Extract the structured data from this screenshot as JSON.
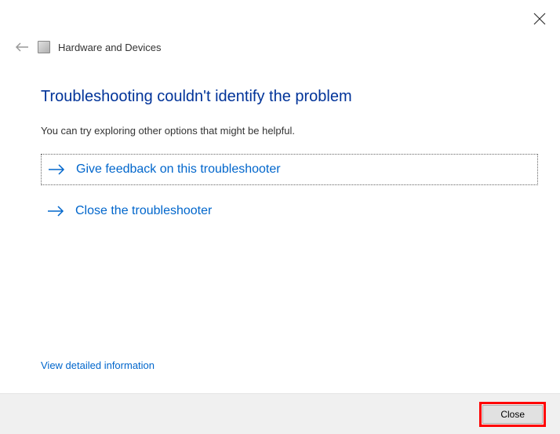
{
  "header": {
    "title": "Hardware and Devices"
  },
  "main": {
    "heading": "Troubleshooting couldn't identify the problem",
    "description": "You can try exploring other options that might be helpful.",
    "options": [
      {
        "label": "Give feedback on this troubleshooter"
      },
      {
        "label": "Close the troubleshooter"
      }
    ],
    "detailed_link": "View detailed information"
  },
  "footer": {
    "close_label": "Close"
  }
}
